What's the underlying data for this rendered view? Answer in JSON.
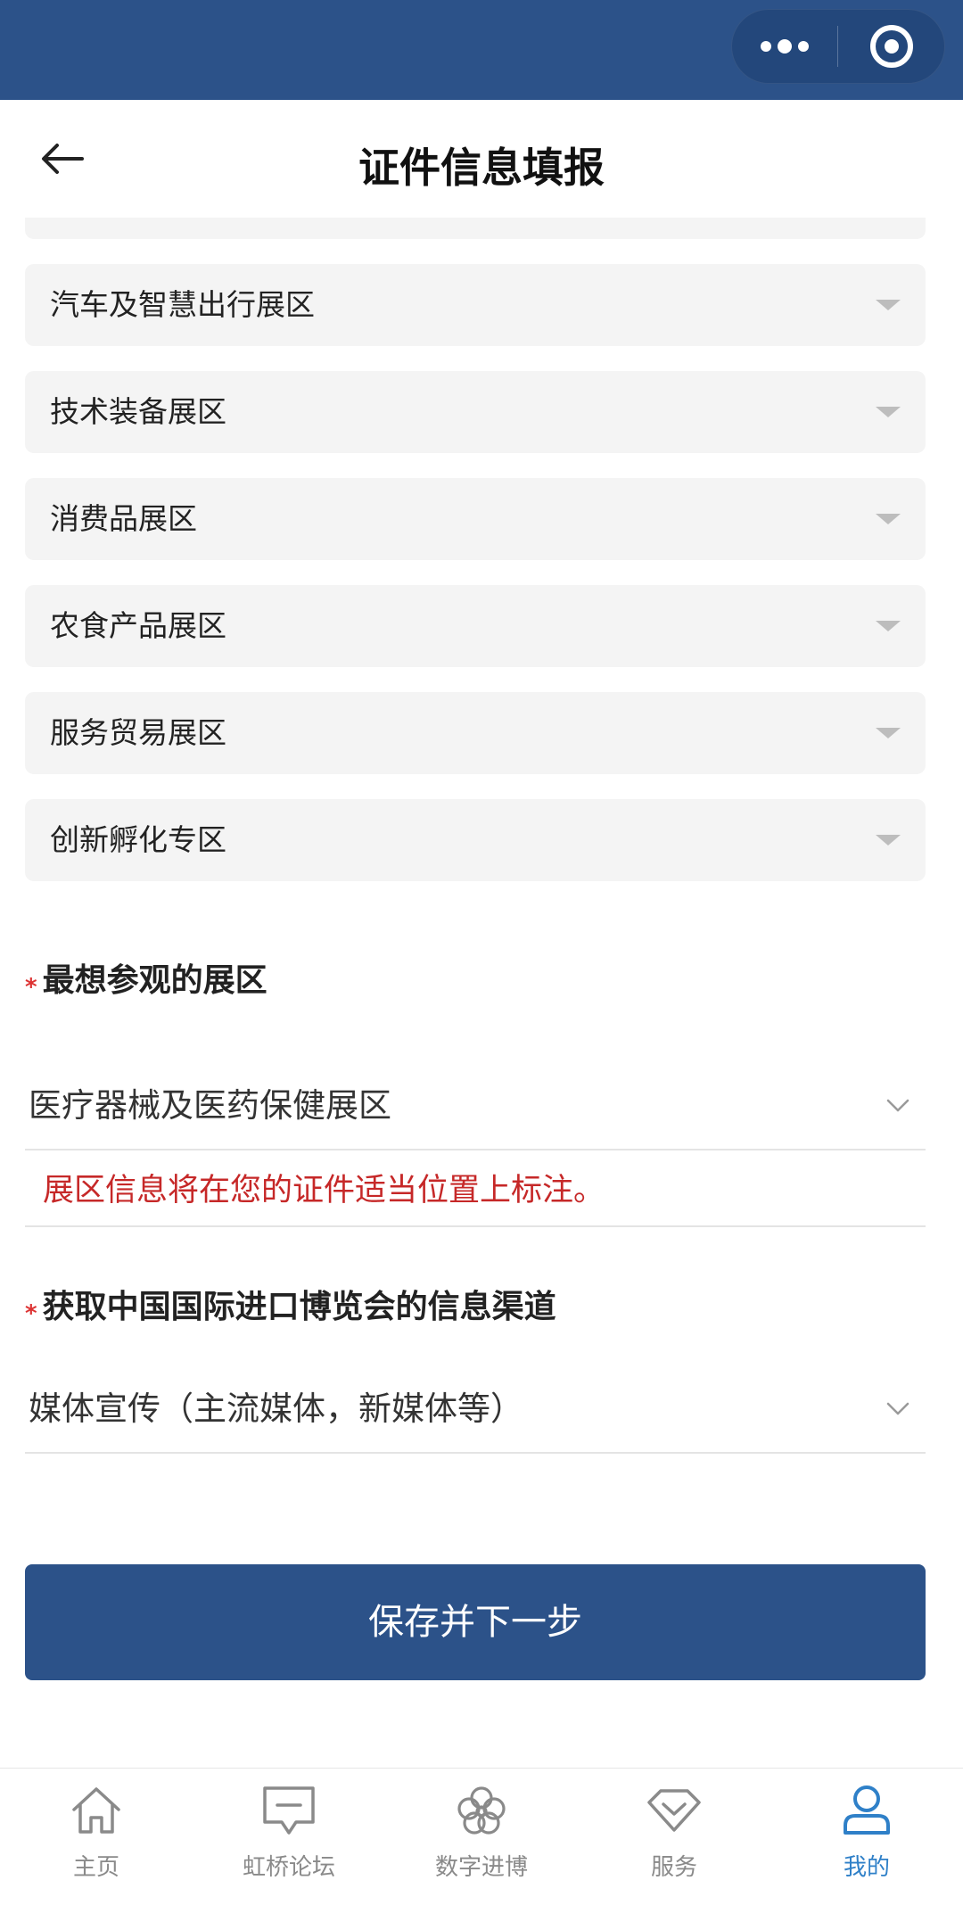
{
  "header": {
    "title": "证件信息填报"
  },
  "zones": [
    {
      "label": "汽车及智慧出行展区"
    },
    {
      "label": "技术装备展区"
    },
    {
      "label": "消费品展区"
    },
    {
      "label": "农食产品展区"
    },
    {
      "label": "服务贸易展区"
    },
    {
      "label": "创新孵化专区"
    }
  ],
  "favorite_zone": {
    "required_mark": "*",
    "title": "最想参观的展区",
    "value": "医疗器械及医药保健展区",
    "hint": "展区信息将在您的证件适当位置上标注。"
  },
  "info_channel": {
    "required_mark": "*",
    "title": "获取中国国际进口博览会的信息渠道",
    "value": "媒体宣传（主流媒体，新媒体等）"
  },
  "submit_label": "保存并下一步",
  "tabs": [
    {
      "label": "主页",
      "icon": "home-icon"
    },
    {
      "label": "虹桥论坛",
      "icon": "forum-icon"
    },
    {
      "label": "数字进博",
      "icon": "clover-icon"
    },
    {
      "label": "服务",
      "icon": "diamond-icon"
    },
    {
      "label": "我的",
      "icon": "user-icon"
    }
  ],
  "colors": {
    "brand": "#2c5289",
    "accent": "#2f80c8",
    "warning": "#c62828",
    "required": "#dd3333"
  }
}
